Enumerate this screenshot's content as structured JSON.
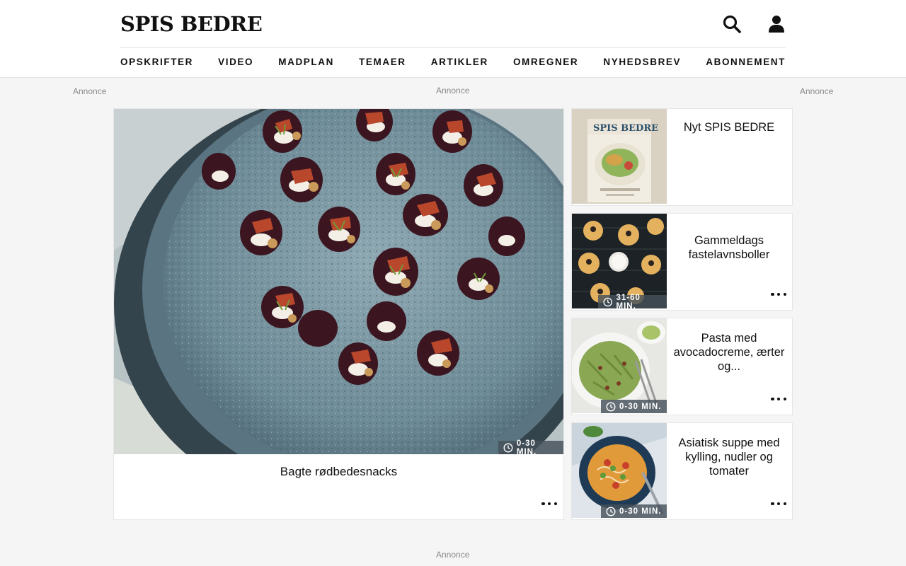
{
  "header": {
    "logo": "SPIS BEDRE",
    "icons": [
      "search-icon",
      "user-icon"
    ]
  },
  "nav": {
    "items": [
      "OPSKRIFTER",
      "VIDEO",
      "MADPLAN",
      "TEMAER",
      "ARTIKLER",
      "OMREGNER",
      "NYHEDSBREV",
      "ABONNEMENT"
    ]
  },
  "ads": {
    "left": "Annonce",
    "center": "Annonce",
    "right": "Annonce",
    "bottom": "Annonce"
  },
  "hero": {
    "title": "Bagte rødbedesnacks",
    "time": "0-30 MIN."
  },
  "cards": [
    {
      "title": "Nyt SPIS BEDRE",
      "time": ""
    },
    {
      "title": "Gammeldags fastelavnsboller",
      "time": "31-60 MIN."
    },
    {
      "title": "Pasta med avocadocreme, ærter og...",
      "time": "0-30 MIN."
    },
    {
      "title": "Asiatisk suppe med kylling, nudler og tomater",
      "time": "0-30 MIN."
    }
  ],
  "magazine_cover_text": "SPIS BEDRE",
  "colors": {
    "background": "#f5f5f5",
    "badge": "#46505a",
    "text": "#111111"
  }
}
